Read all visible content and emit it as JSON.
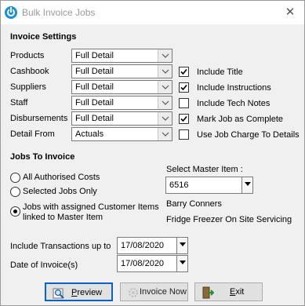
{
  "window": {
    "title": "Bulk Invoice Jobs",
    "close_glyph": "✕",
    "icon": "power-app-icon"
  },
  "invoice_settings": {
    "heading": "Invoice Settings",
    "rows": [
      {
        "label": "Products",
        "value": "Full Detail"
      },
      {
        "label": "Cashbook",
        "value": "Full Detail"
      },
      {
        "label": "Suppliers",
        "value": "Full Detail"
      },
      {
        "label": "Staff",
        "value": "Full Detail"
      },
      {
        "label": "Disbursements",
        "value": "Full Detail"
      },
      {
        "label": "Detail From",
        "value": "Actuals"
      }
    ],
    "checkboxes": [
      {
        "label": "Include Title",
        "checked": true
      },
      {
        "label": "Include Instructions",
        "checked": true
      },
      {
        "label": "Include Tech Notes",
        "checked": false
      },
      {
        "label": "Mark Job as Complete",
        "checked": true
      },
      {
        "label": "Use Job Charge To Details",
        "checked": false
      }
    ]
  },
  "jobs_to_invoice": {
    "heading": "Jobs To Invoice",
    "options": [
      {
        "label": "All Authorised Costs",
        "selected": false
      },
      {
        "label": "Selected Jobs Only",
        "selected": false
      },
      {
        "label_line1": "Jobs with assigned Customer Items",
        "label_line2": "linked to Master Item",
        "selected": true
      }
    ],
    "master_item": {
      "label": "Select Master Item :",
      "value": "6516",
      "customer": "Barry Conners",
      "description": "Fridge Freezer On Site Servicing"
    }
  },
  "dates": {
    "include_transactions_label": "Include Transactions up to",
    "include_transactions_value": "17/08/2020",
    "invoice_date_label": "Date of Invoice(s)",
    "invoice_date_value": "17/08/2020"
  },
  "buttons": {
    "preview_accel": "P",
    "preview_rest": "review",
    "invoice_now_label": "Invoice Now",
    "exit_accel": "E",
    "exit_rest": "xit"
  },
  "colors": {
    "primary_border": "#0a62c9",
    "app_icon": "#1b8fd6",
    "title_text": "#9a9a9a"
  }
}
